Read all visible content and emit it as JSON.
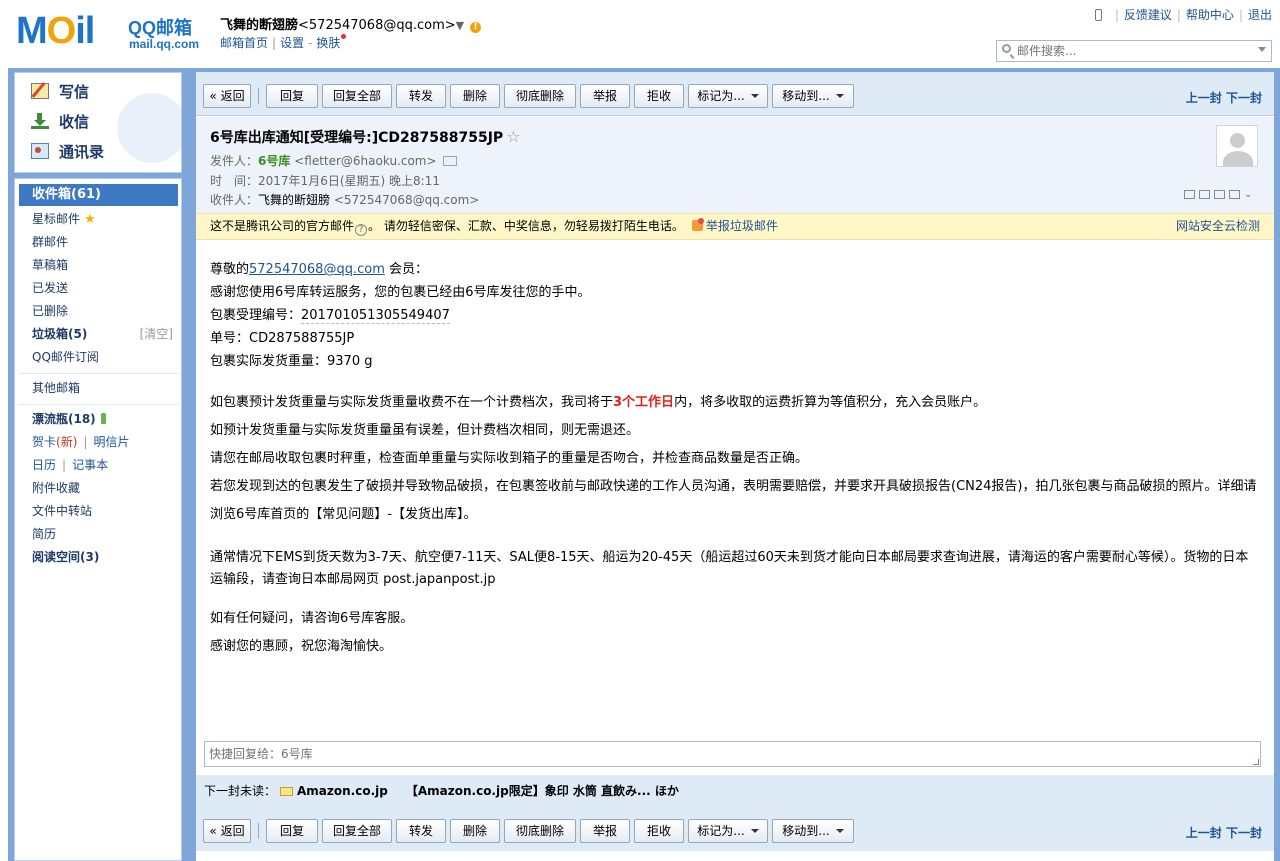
{
  "logo": {
    "brand": "QQ邮箱",
    "domain": "mail.qq.com",
    "letters_a": "M",
    "letter_o": "O",
    "letters_b": "il"
  },
  "user": {
    "name": "飞舞的断翅膀",
    "email": "<572547068@qq.com>",
    "drop": "▼",
    "warn": "!"
  },
  "user_links": {
    "home": "邮箱首页",
    "settings": "设置",
    "skin": "换肤",
    "sep": "|",
    "dash": "-"
  },
  "top_links": {
    "feedback": "反馈建议",
    "help": "帮助中心",
    "logout": "退出",
    "sep": "|"
  },
  "search": {
    "placeholder": "邮件搜索..."
  },
  "sidebar_main": {
    "write": "写信",
    "receive": "收信",
    "contacts": "通讯录"
  },
  "folders": {
    "inbox": "收件箱(61)",
    "starred": "星标邮件",
    "group": "群邮件",
    "drafts": "草稿箱",
    "sent": "已发送",
    "deleted": "已删除",
    "spam": "垃圾箱(5)",
    "spam_clear": "[清空]",
    "subscription": "QQ邮件订阅",
    "other": "其他邮箱",
    "drift": "漂流瓶(18)",
    "greeting": "贺卡",
    "greeting_new": "(新)",
    "postcard": "明信片",
    "calendar": "日历",
    "notes": "记事本",
    "attachments": "附件收藏",
    "transfer": "文件中转站",
    "resume": "简历",
    "reading": "阅读空间(3)",
    "pipe": "|"
  },
  "toolbar": {
    "back": "« 返回",
    "reply": "回复",
    "reply_all": "回复全部",
    "forward": "转发",
    "delete": "删除",
    "delete_perm": "彻底删除",
    "report": "举报",
    "reject": "拒收",
    "mark_as": "标记为...",
    "move_to": "移动到...",
    "prev": "上一封",
    "next": "下一封"
  },
  "mail": {
    "subject": "6号库出库通知[受理编号:]CD287588755JP",
    "star": "☆",
    "from_label": "发件人：",
    "from_name": "6号库",
    "from_email": "<fletter@6haoku.com>",
    "time_label": "时　间：",
    "time": "2017年1月6日(星期五) 晚上8:11",
    "to_label": "收件人：",
    "to_name": "飞舞的断翅膀",
    "to_email": "<572547068@qq.com>"
  },
  "notice": {
    "text1": "这不是腾讯公司的官方邮件",
    "q": "?",
    "text2": "。 请勿轻信密保、汇款、中奖信息，勿轻易拨打陌生电话。",
    "report_spam": "举报垃圾邮件",
    "security": "网站安全云检测"
  },
  "body": {
    "greet_pre": "尊敬的",
    "greet_link": "572547068@qq.com",
    "greet_post": " 会员：",
    "l2": "感谢您使用6号库转运服务，您的包裹已经由6号库发往您的手中。",
    "l3_label": "包裹受理编号：",
    "l3_value": "20170105130554940​7",
    "l4": "单号：CD287588755JP",
    "l5": "包裹实际发货重量：9370 g",
    "p1_pre": "如包裹预计发货重量与实际发货重量收费不在一个计费档次，我司将于",
    "p1_red": "3个工作日",
    "p1_post": "内，将多收取的运费折算为等值积分，充入会员账户。",
    "p2": "如预计发货重量与实际发货重量虽有误差，但计费档次相同，则无需退还。",
    "p3": "请您在邮局收取包裹时秤重，检查面单重量与实际收到箱子的重量是否吻合，并检查商品数量是否正确。",
    "p4": "若您发现到达的包裹发生了破损并导致物品破损，在包裹签收前与邮政快递的工作人员沟通，表明需要赔偿，并要求开具破损报告(CN24报告)，拍几张包裹与商品破损的照片。详细请浏览6号库首页的【常见问题】-【发货出库】。",
    "p5": "通常情况下EMS到货天数为3-7天、航空便7-11天、SAL便8-15天、船运为20-45天（船运超过60天未到货才能向日本邮局要求查询进展，请海运的客户需要耐心等候）。货物的日本运输段，请查询日本邮局网页 post.japanpost.jp",
    "p6": "如有任何疑问，请咨询6号库客服。",
    "p7": "感谢您的惠顾，祝您海淘愉快。"
  },
  "quick_reply": {
    "placeholder": "快捷回复给：6号库"
  },
  "next_unread": {
    "label": "下一封未读：",
    "from": "Amazon.co.jp",
    "subject": "【Amazon.co.jp限定】象印 水筒 直飲み... ほか"
  }
}
